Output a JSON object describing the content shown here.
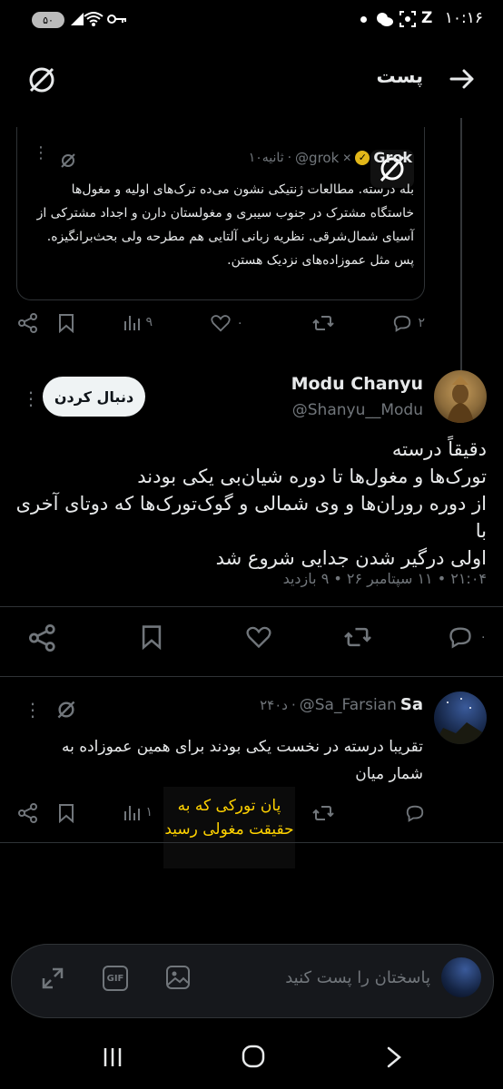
{
  "status_bar": {
    "time": "۱۰:۱۶",
    "battery": "۵۰"
  },
  "header": {
    "title": "پست"
  },
  "grok_quote": {
    "name": "Grok",
    "handle": "@grok",
    "time": "۱۰ثانیه",
    "text": "بله درسته. مطالعات ژنتیکی نشون می‌ده ترک‌های اولیه و مغول‌ها خاستگاه مشترک در جنوب سیبری و مغولستان دارن و اجداد مشترکی از آسیای شمال‌شرقی. نظریه زبانی آلتایی هم مطرحه ولی بحث‌برانگیزه. پس مثل عموزاده‌های نزدیک هستن."
  },
  "grok_actions": {
    "replies": "۲",
    "likes": "۰",
    "views": "۹"
  },
  "main_post": {
    "name": "Modu Chanyu",
    "handle": "@Shanyu__Modu",
    "follow_label": "دنبال کردن",
    "lines": [
      "دقیقاً درسته",
      "تورک‌ها و مغول‌ها تا دوره شیان‌بی یکی بودند",
      "از دوره روران‌ها و وی شمالی و گوک‌تورک‌ها که دوتای آخری با",
      "اولی درگیر شدن جدایی شروع شد"
    ],
    "meta": "۲۱:۰۴ • ۱۱ سپتامبر ۲۶ • ۹ بازدید",
    "replies": "۰"
  },
  "reply_post": {
    "name": "Sa",
    "handle": "@Sa_Farsian",
    "time": "۲۴۰د",
    "text": "تقریبا درسته در نخست یکی بودند برای همین عموزاده به شمار میان",
    "views": "۱"
  },
  "overlay_note": {
    "text": "پان تورکی که به حقیقت مغولی رسید"
  },
  "composer": {
    "placeholder": "پاسختان را پست کنید",
    "gif_label": "GIF"
  },
  "colors": {
    "accent": "#1d9bf0",
    "muted": "#71767b",
    "note": "#ffd200"
  }
}
